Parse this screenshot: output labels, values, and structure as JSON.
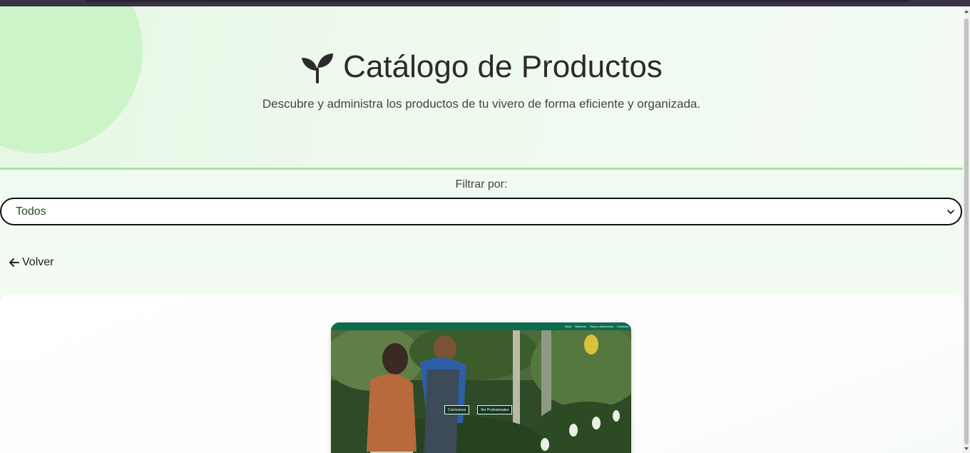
{
  "hero": {
    "title": "Catálogo de Productos",
    "subtitle": "Descubre y administra los productos de tu vivero de forma eficiente y organizada.",
    "icon": "sprout-icon"
  },
  "filter": {
    "label": "Filtrar por:",
    "selected": "Todos"
  },
  "back": {
    "label": "Volver",
    "icon": "arrow-left-icon"
  },
  "card": {
    "nav_items": [
      "Inicio",
      "Nosotros",
      "Ropa y accesorios",
      "Contacto"
    ],
    "btn_primary": "Conócenos",
    "btn_secondary": "Ver Profesionales"
  },
  "colors": {
    "accent_green": "#a3e39d",
    "card_nav": "#0f6b4e",
    "text_dark": "#2b2b2b"
  }
}
